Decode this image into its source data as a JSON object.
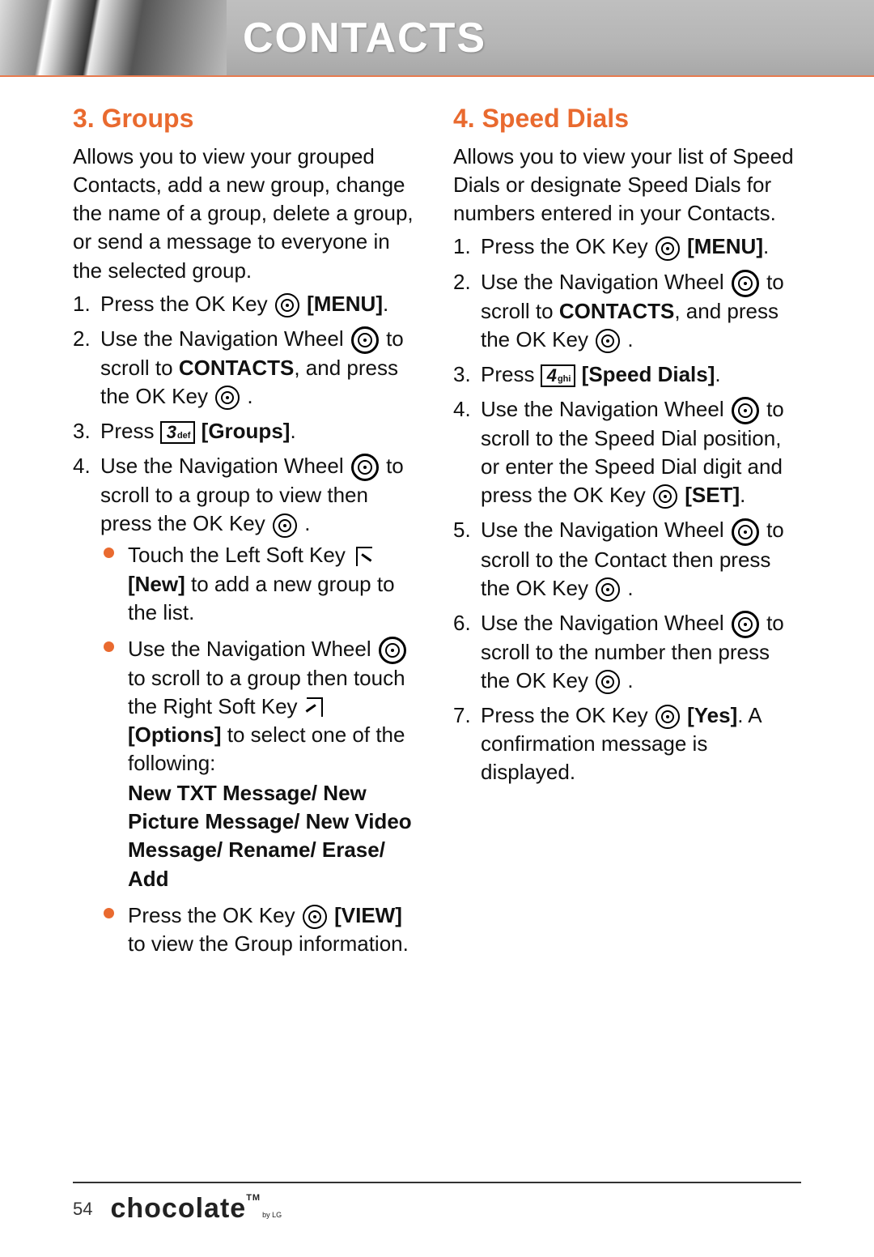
{
  "header": {
    "title": "CONTACTS"
  },
  "left": {
    "title": "3. Groups",
    "intro": "Allows you to view your grouped Contacts, add a new group, change the name of a group, delete a group, or send a message to everyone in the selected group.",
    "s1a": "Press the OK Key ",
    "s1b": "[MENU]",
    "s1c": ".",
    "s2a": "Use the Navigation Wheel ",
    "s2b": " to scroll to ",
    "s2c": "CONTACTS",
    "s2d": ", and press the OK Key ",
    "s2e": " .",
    "s3a": "Press ",
    "key3_num": "3",
    "key3_txt": "def",
    "s3b": "[Groups]",
    "s3c": ".",
    "s4a": "Use the Navigation Wheel ",
    "s4b": " to scroll to a group to view then press the OK Key ",
    "s4c": " .",
    "b1a": "Touch the Left Soft Key ",
    "b1b": "[New]",
    "b1c": " to add a new group to the list.",
    "b2a": "Use the Navigation Wheel ",
    "b2b": " to scroll to a group then touch the Right Soft Key ",
    "b2c": "[Options]",
    "b2d": " to select one of the following:",
    "opts": "New TXT Message/ New Picture Message/ New Video Message/ Rename/ Erase/ Add",
    "b3a": "Press the OK Key ",
    "b3b": "[VIEW]",
    "b3c": " to view the Group information."
  },
  "right": {
    "title": "4. Speed Dials",
    "intro": "Allows you to view your list of Speed Dials or designate Speed Dials for numbers entered in your Contacts.",
    "s1a": "Press the OK Key ",
    "s1b": "[MENU]",
    "s1c": ".",
    "s2a": "Use the Navigation Wheel ",
    "s2b": " to scroll to ",
    "s2c": "CONTACTS",
    "s2d": ", and press the OK Key ",
    "s2e": " .",
    "s3a": "Press ",
    "key4_num": "4",
    "key4_txt": "ghi",
    "s3b": "[Speed Dials]",
    "s3c": ".",
    "s4a": "Use the Navigation Wheel ",
    "s4b": " to scroll to the Speed Dial position, or enter the Speed Dial digit and press the OK Key ",
    "s4c": "[SET]",
    "s4d": ".",
    "s5a": "Use the Navigation Wheel ",
    "s5b": " to scroll to the Contact then press the OK Key ",
    "s5c": " .",
    "s6a": "Use the Navigation Wheel ",
    "s6b": " to scroll to the number then press the OK Key ",
    "s6c": " .",
    "s7a": "Press the OK Key ",
    "s7b": "[Yes]",
    "s7c": ". A confirmation message is displayed."
  },
  "footer": {
    "page": "54",
    "brand": "chocolate",
    "tm": "TM",
    "by": "by LG"
  }
}
